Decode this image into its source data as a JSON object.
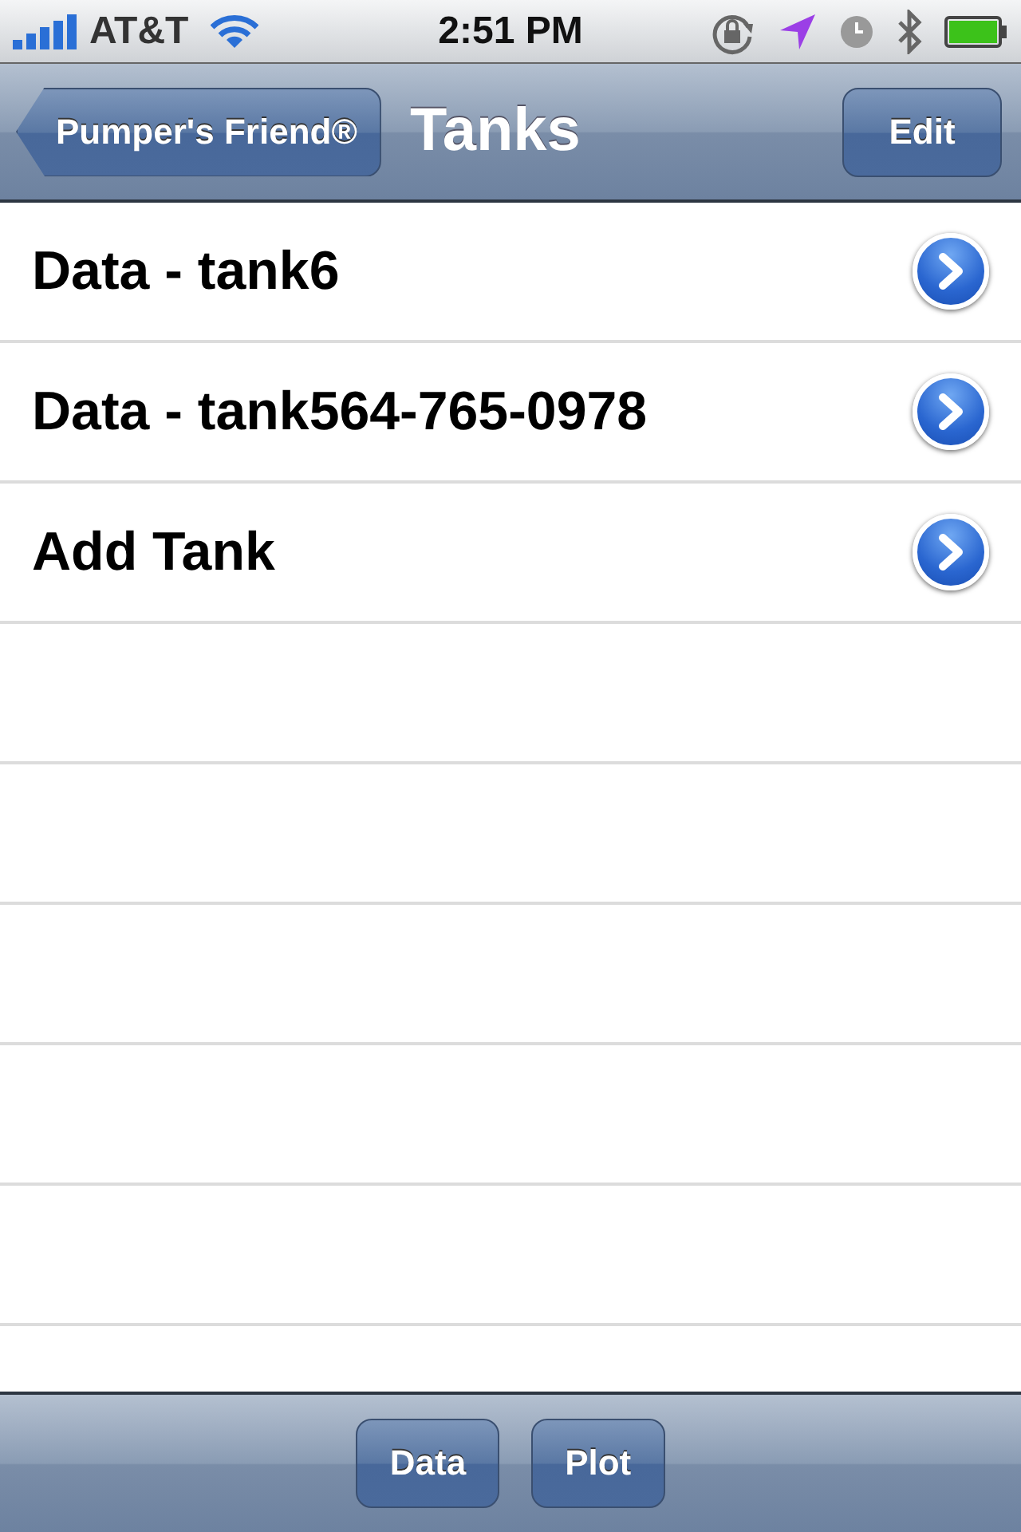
{
  "status_bar": {
    "carrier": "AT&T",
    "time": "2:51 PM"
  },
  "nav_bar": {
    "back_button": "Pumper's Friend®",
    "title": "Tanks",
    "edit_button": "Edit"
  },
  "rows": [
    {
      "label": "Data - tank6"
    },
    {
      "label": "Data - tank564-765-0978"
    },
    {
      "label": "Add Tank"
    }
  ],
  "toolbar": {
    "buttons": [
      "Data",
      "Plot"
    ]
  }
}
